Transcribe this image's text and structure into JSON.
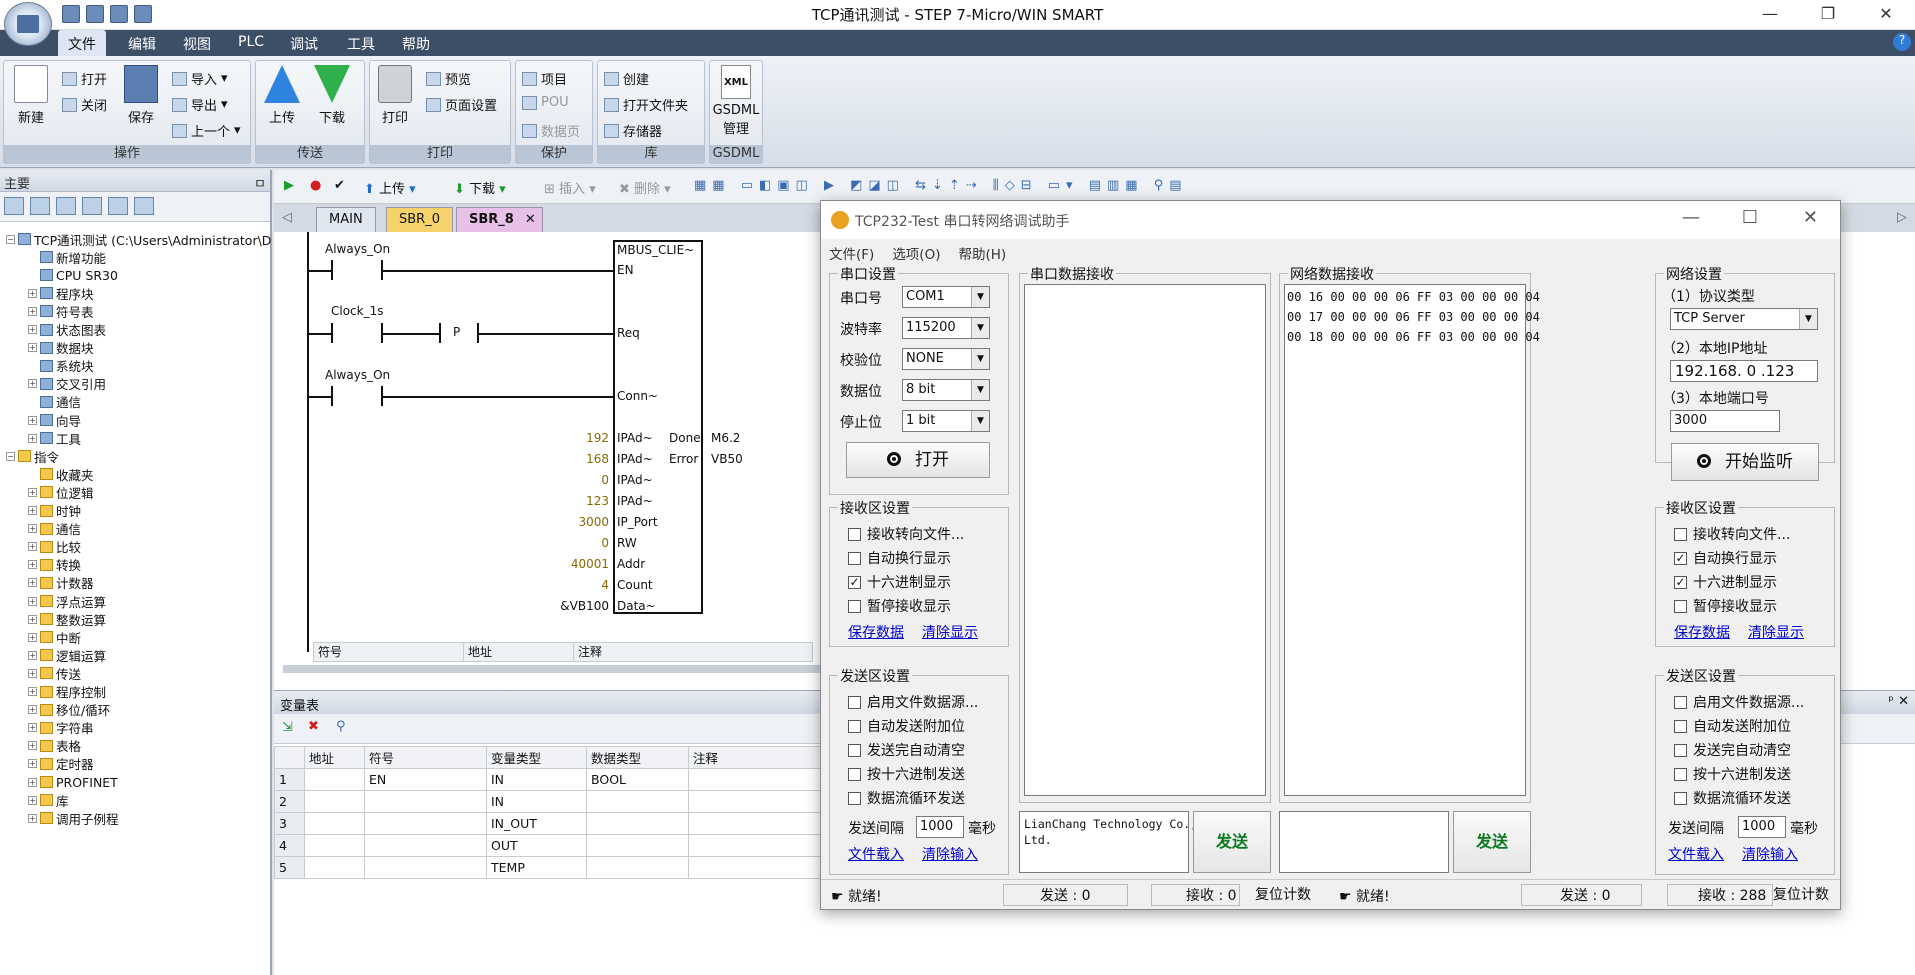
{
  "app": {
    "title": "TCP通讯测试 - STEP 7-Micro/WIN SMART",
    "win_min": "—",
    "win_max": "❐",
    "win_close": "✕"
  },
  "menu": [
    "文件",
    "编辑",
    "视图",
    "PLC",
    "调试",
    "工具",
    "帮助"
  ],
  "ribbon": {
    "new": "新建",
    "open": "打开",
    "close": "关闭",
    "save": "保存",
    "import": "导入",
    "export": "导出",
    "prev": "上一个",
    "grp_ops": "操作",
    "upload": "上传",
    "download": "下载",
    "grp_transfer": "传送",
    "print": "打印",
    "preview": "预览",
    "page_setup": "页面设置",
    "grp_print": "打印",
    "project": "项目",
    "pou": "POU",
    "datapage": "数据页",
    "grp_protect": "保护",
    "create": "创建",
    "open_folder": "打开文件夹",
    "storage": "存储器",
    "grp_lib": "库",
    "gsdml_icon": "XML",
    "gsdml": "GSDML",
    "gsdml2": "管理",
    "grp_gsdml": "GSDML"
  },
  "left": {
    "header": "主要",
    "pin": "ㅁ",
    "tree": [
      {
        "label": "TCP通讯测试 (C:\\Users\\Administrator\\D",
        "lvl": 0,
        "exp": "-"
      },
      {
        "label": "新增功能",
        "lvl": 1,
        "exp": ""
      },
      {
        "label": "CPU SR30",
        "lvl": 1,
        "exp": ""
      },
      {
        "label": "程序块",
        "lvl": 1,
        "exp": "+"
      },
      {
        "label": "符号表",
        "lvl": 1,
        "exp": "+"
      },
      {
        "label": "状态图表",
        "lvl": 1,
        "exp": "+"
      },
      {
        "label": "数据块",
        "lvl": 1,
        "exp": "+"
      },
      {
        "label": "系统块",
        "lvl": 1,
        "exp": ""
      },
      {
        "label": "交叉引用",
        "lvl": 1,
        "exp": "+"
      },
      {
        "label": "通信",
        "lvl": 1,
        "exp": ""
      },
      {
        "label": "向导",
        "lvl": 1,
        "exp": "+"
      },
      {
        "label": "工具",
        "lvl": 1,
        "exp": "+"
      },
      {
        "label": "指令",
        "lvl": 0,
        "exp": "-"
      },
      {
        "label": "收藏夹",
        "lvl": 1,
        "exp": ""
      },
      {
        "label": "位逻辑",
        "lvl": 1,
        "exp": "+"
      },
      {
        "label": "时钟",
        "lvl": 1,
        "exp": "+"
      },
      {
        "label": "通信",
        "lvl": 1,
        "exp": "+"
      },
      {
        "label": "比较",
        "lvl": 1,
        "exp": "+"
      },
      {
        "label": "转换",
        "lvl": 1,
        "exp": "+"
      },
      {
        "label": "计数器",
        "lvl": 1,
        "exp": "+"
      },
      {
        "label": "浮点运算",
        "lvl": 1,
        "exp": "+"
      },
      {
        "label": "整数运算",
        "lvl": 1,
        "exp": "+"
      },
      {
        "label": "中断",
        "lvl": 1,
        "exp": "+"
      },
      {
        "label": "逻辑运算",
        "lvl": 1,
        "exp": "+"
      },
      {
        "label": "传送",
        "lvl": 1,
        "exp": "+"
      },
      {
        "label": "程序控制",
        "lvl": 1,
        "exp": "+"
      },
      {
        "label": "移位/循环",
        "lvl": 1,
        "exp": "+"
      },
      {
        "label": "字符串",
        "lvl": 1,
        "exp": "+"
      },
      {
        "label": "表格",
        "lvl": 1,
        "exp": "+"
      },
      {
        "label": "定时器",
        "lvl": 1,
        "exp": "+"
      },
      {
        "label": "PROFINET",
        "lvl": 1,
        "exp": "+"
      },
      {
        "label": "库",
        "lvl": 1,
        "exp": "+"
      },
      {
        "label": "调用子例程",
        "lvl": 1,
        "exp": "+"
      }
    ]
  },
  "editor": {
    "upload": "上传",
    "download": "下载",
    "insert": "插入",
    "delete": "删除",
    "tabs": [
      "MAIN",
      "SBR_0",
      "SBR_8"
    ],
    "tab_close": "✕"
  },
  "ladder": {
    "c1": "Always_On",
    "c2": "Clock_1s",
    "p": "P",
    "c3": "Always_On",
    "block": "MBUS_CLIE~",
    "en": "EN",
    "req": "Req",
    "conn": "Conn~",
    "ipad": "IPAd~",
    "done": "Done",
    "error": "Error",
    "done_v": "M6.2",
    "error_v": "VB50",
    "ip_port": "IP_Port",
    "rw": "RW",
    "addr": "Addr",
    "count": "Count",
    "data": "Data~",
    "v1": "192",
    "v2": "168",
    "v3": "0",
    "v4": "123",
    "v5": "3000",
    "v6": "0",
    "v7": "40001",
    "v8": "4",
    "v9": "&VB100",
    "sym_cols": [
      "符号",
      "地址",
      "注释"
    ]
  },
  "vartable": {
    "title": "变量表",
    "pin": "ᵖ ✕",
    "headers": [
      "",
      "地址",
      "符号",
      "变量类型",
      "数据类型",
      "注释"
    ],
    "rows": [
      [
        "1",
        "",
        "EN",
        "IN",
        "BOOL",
        ""
      ],
      [
        "2",
        "",
        "",
        "IN",
        "",
        ""
      ],
      [
        "3",
        "",
        "",
        "IN_OUT",
        "",
        ""
      ],
      [
        "4",
        "",
        "",
        "OUT",
        "",
        ""
      ],
      [
        "5",
        "",
        "",
        "TEMP",
        "",
        ""
      ]
    ]
  },
  "dlg": {
    "title": "TCP232-Test 串口转网络调试助手",
    "menu": [
      "文件(F)",
      "选项(O)",
      "帮助(H)"
    ],
    "serial": {
      "legend": "串口设置",
      "port_l": "串口号",
      "port": "COM1",
      "baud_l": "波特率",
      "baud": "115200",
      "parity_l": "校验位",
      "parity": "NONE",
      "data_l": "数据位",
      "data": "8 bit",
      "stop_l": "停止位",
      "stop": "1 bit",
      "open": "打开"
    },
    "recv_serial": {
      "legend": "接收区设置",
      "o1": "接收转向文件...",
      "o2": "自动换行显示",
      "o3": "十六进制显示",
      "o4": "暂停接收显示",
      "save": "保存数据",
      "clear": "清除显示"
    },
    "send_serial": {
      "legend": "发送区设置",
      "o1": "启用文件数据源...",
      "o2": "自动发送附加位",
      "o3": "发送完自动清空",
      "o4": "按十六进制发送",
      "o5": "数据流循环发送",
      "interval_l": "发送间隔",
      "interval": "1000",
      "ms": "毫秒",
      "load": "文件载入",
      "clear": "清除输入"
    },
    "serial_recv_title": "串口数据接收",
    "net_recv_title": "网络数据接收",
    "net_lines": [
      "00 16 00 00 00 06 FF 03 00 00 00 04",
      "00 17 00 00 00 06 FF 03 00 00 00 04",
      "00 18 00 00 00 06 FF 03 00 00 00 04"
    ],
    "net": {
      "legend": "网络设置",
      "proto_l": "（1）协议类型",
      "proto": "TCP Server",
      "ip_l": "（2）本地IP地址",
      "ip": "192.168. 0 .123",
      "port_l": "（3）本地端口号",
      "port": "3000",
      "listen": "开始监听"
    },
    "recv_net": {
      "legend": "接收区设置",
      "o1": "接收转向文件...",
      "o2": "自动换行显示",
      "o3": "十六进制显示",
      "o4": "暂停接收显示",
      "save": "保存数据",
      "clear": "清除显示"
    },
    "send_net": {
      "legend": "发送区设置",
      "o1": "启用文件数据源...",
      "o2": "自动发送附加位",
      "o3": "发送完自动清空",
      "o4": "按十六进制发送",
      "o5": "数据流循环发送",
      "interval_l": "发送间隔",
      "interval": "1000",
      "ms": "毫秒",
      "load": "文件载入",
      "clear": "清除输入"
    },
    "serial_send_text": "LianChang Technology Co.,\nLtd.",
    "send": "发送",
    "status_ready": "就绪!",
    "s_send": "发送 : 0",
    "s_recv": "接收 : 0",
    "s_reset": "复位计数",
    "n_send": "发送 : 0",
    "n_recv": "接收 : 288",
    "n_reset": "复位计数"
  }
}
